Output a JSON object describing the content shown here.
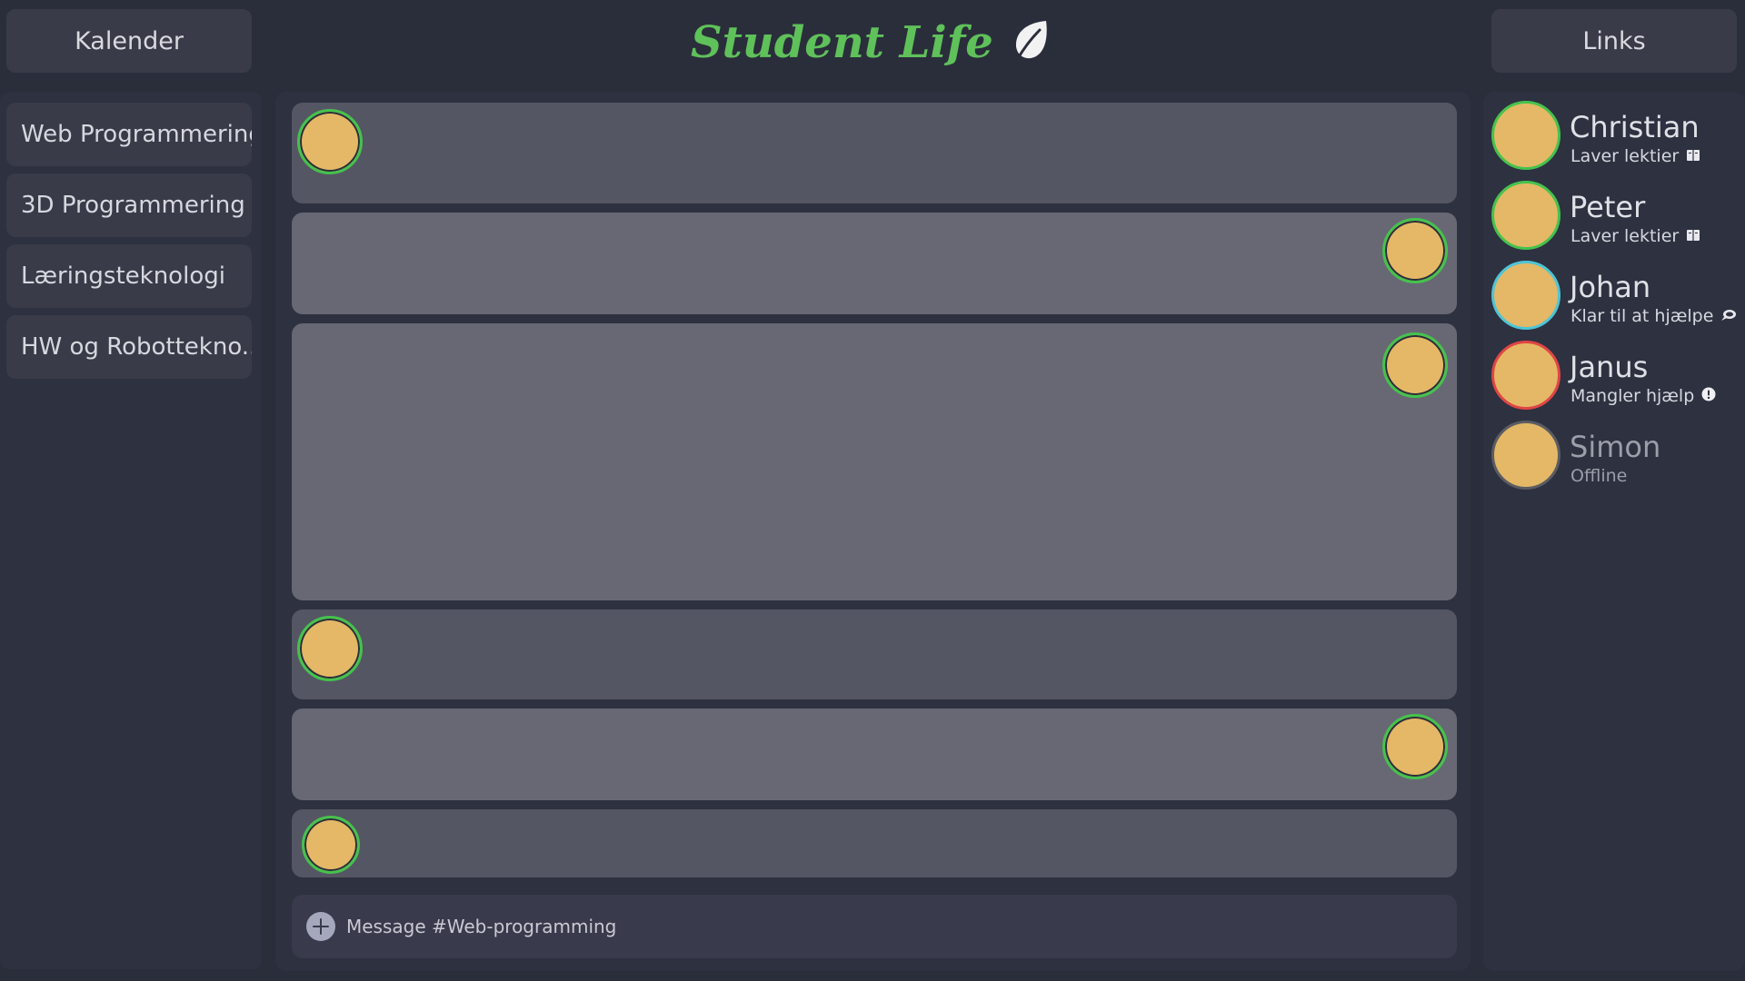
{
  "header": {
    "left_button": "Kalender",
    "title": "Student Life",
    "right_button": "Links"
  },
  "colors": {
    "brand": "#5fc15a",
    "online": "#45c24d",
    "helping": "#4fc4d6",
    "needs_help": "#e04545",
    "offline": "#5b5c62",
    "avatar": "#e4b866"
  },
  "channels": [
    {
      "label": "Web Programmering"
    },
    {
      "label": "3D Programmering"
    },
    {
      "label": "Læringsteknologi"
    },
    {
      "label": "HW og Robottekno.."
    }
  ],
  "messages": [
    {
      "side": "left",
      "shade": "dark"
    },
    {
      "side": "right",
      "shade": "light"
    },
    {
      "side": "right",
      "shade": "light"
    },
    {
      "side": "left",
      "shade": "dark"
    },
    {
      "side": "right",
      "shade": "light"
    },
    {
      "side": "left",
      "shade": "dark"
    }
  ],
  "composer": {
    "placeholder": "Message #Web-programming"
  },
  "users": [
    {
      "name": "Christian",
      "status": "Laver lektier",
      "state": "online",
      "icon": "book-icon"
    },
    {
      "name": "Peter",
      "status": "Laver lektier",
      "state": "online",
      "icon": "book-icon"
    },
    {
      "name": "Johan",
      "status": "Klar til at hjælpe",
      "state": "helping",
      "icon": "chat-bubble-icon"
    },
    {
      "name": "Janus",
      "status": "Mangler hjælp",
      "state": "needs_help",
      "icon": "exclamation-icon"
    },
    {
      "name": "Simon",
      "status": "Offline",
      "state": "offline",
      "icon": ""
    }
  ]
}
